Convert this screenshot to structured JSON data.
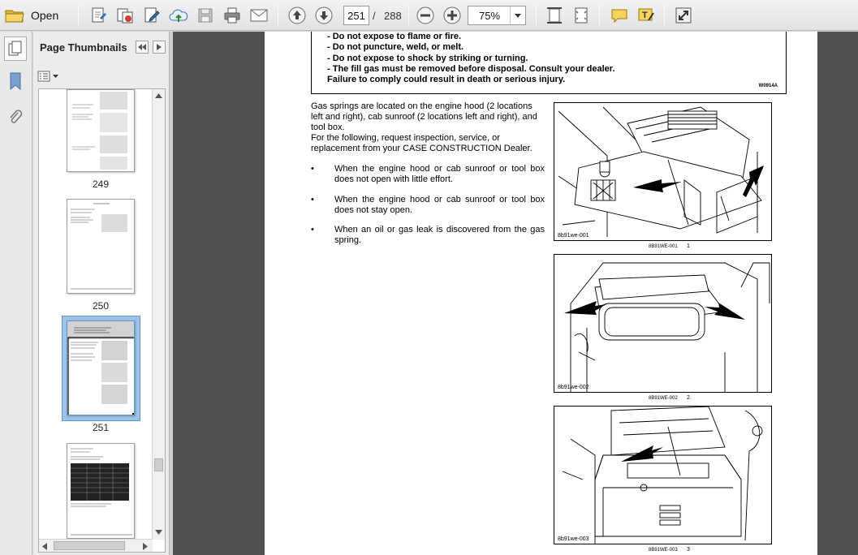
{
  "toolbar": {
    "open_label": "Open",
    "page_current": "251",
    "page_separator": "/",
    "page_total": "288",
    "zoom_value": "75%"
  },
  "thumbnails_panel": {
    "title": "Page Thumbnails",
    "pages": [
      {
        "label": "249"
      },
      {
        "label": "250"
      },
      {
        "label": "251",
        "selected": true
      },
      {
        "label": ""
      }
    ]
  },
  "document": {
    "warning_lines": [
      "- Do not expose to flame or fire.",
      "- Do not puncture, weld, or melt.",
      "- Do not expose to shock by striking or turning.",
      "- The fill gas must be removed before disposal.  Consult your dealer.",
      "Failure to comply could result in death or serious injury."
    ],
    "warning_code": "W0914A",
    "intro_paragraphs": [
      "Gas springs are located on the engine hood (2 locations left and right), cab sunroof (2 locations left and right), and tool box.",
      "For the following, request inspection, service, or replacement from your CASE CONSTRUCTION Dealer."
    ],
    "bullet_symbol": "•",
    "bullets": [
      "When the engine hood or cab sunroof or tool box does not open with little effort.",
      "When the engine hood or cab sunroof or tool box does not stay open.",
      "When an oil or gas leak is discovered from the gas spring."
    ],
    "figures": [
      {
        "tag": "8b91we-001",
        "caption": "8B91WE-001",
        "number": "1"
      },
      {
        "tag": "8b91we-002",
        "caption": "8B91WE-002",
        "number": "2"
      },
      {
        "tag": "8b91we-003",
        "caption": "8B91WE-003",
        "number": "3"
      }
    ]
  },
  "colors": {
    "toolbar_bg": "#e8e8e8",
    "doc_bg": "#515151",
    "thumb_selected": "#9fc2e7",
    "icon_blue": "#3a6fb5",
    "icon_yellow": "#f1c232"
  }
}
